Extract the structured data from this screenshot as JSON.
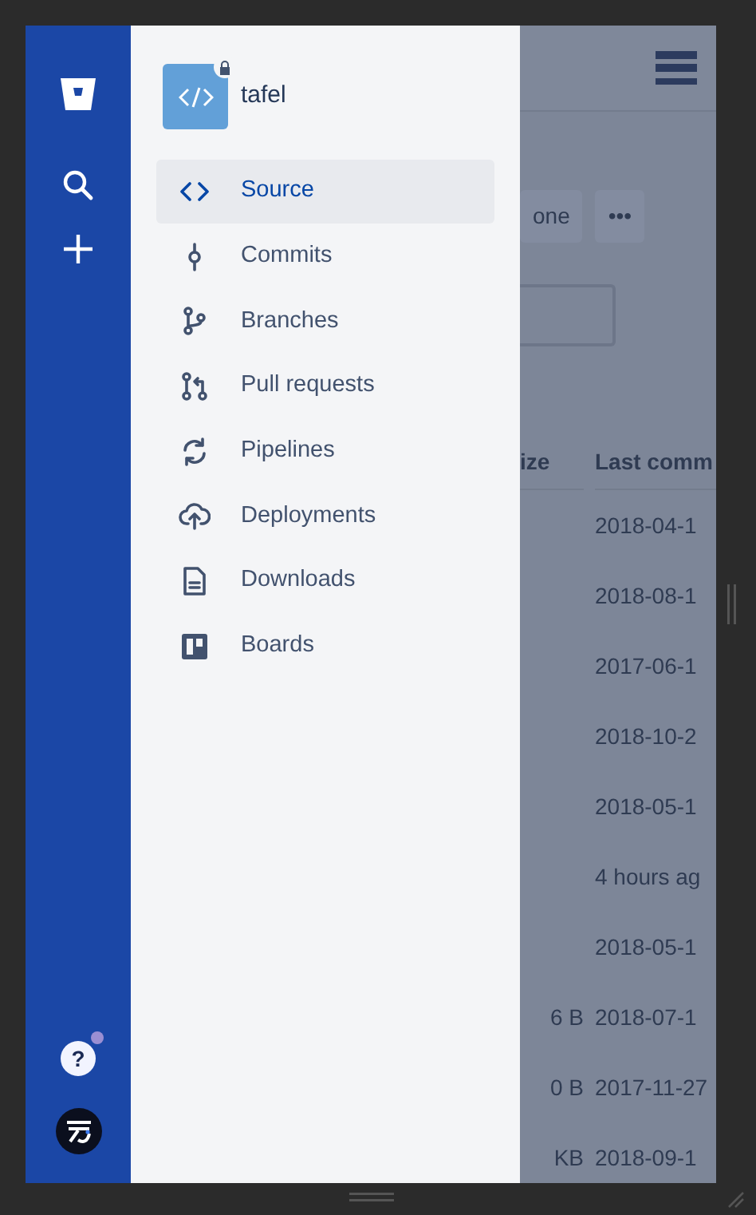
{
  "repository": {
    "name": "tafel",
    "private": true
  },
  "nav_items": [
    {
      "label": "Source",
      "selected": true
    },
    {
      "label": "Commits",
      "selected": false
    },
    {
      "label": "Branches",
      "selected": false
    },
    {
      "label": "Pull requests",
      "selected": false
    },
    {
      "label": "Pipelines",
      "selected": false
    },
    {
      "label": "Deployments",
      "selected": false
    },
    {
      "label": "Downloads",
      "selected": false
    },
    {
      "label": "Boards",
      "selected": false
    }
  ],
  "help": {
    "symbol": "?",
    "has_notification": true
  },
  "background": {
    "buttons": [
      "one",
      "•••"
    ],
    "table": {
      "columns": [
        "ize",
        "Last comm"
      ],
      "rows": [
        {
          "last_commit": "2018-04-1"
        },
        {
          "last_commit": "2018-08-1"
        },
        {
          "last_commit": "2017-06-1"
        },
        {
          "last_commit": "2018-10-2"
        },
        {
          "last_commit": "2018-05-1"
        },
        {
          "last_commit": "4 hours ag"
        },
        {
          "last_commit": "2018-05-1"
        },
        {
          "size": "6 B",
          "last_commit": "2018-07-1"
        },
        {
          "size": "0 B",
          "last_commit": "2017-11-27"
        },
        {
          "size": "KB",
          "last_commit": "2018-09-1"
        }
      ]
    }
  }
}
